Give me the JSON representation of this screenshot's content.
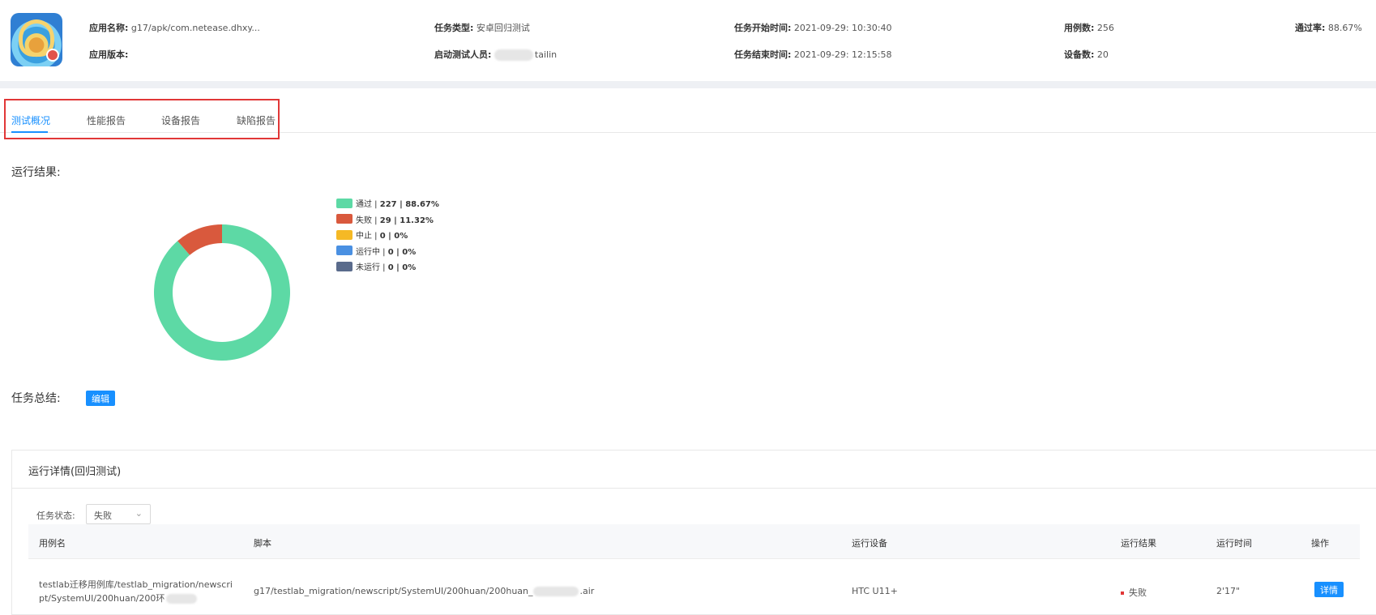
{
  "header": {
    "app_name_label": "应用名称:",
    "app_name_value": "g17/apk/com.netease.dhxy...",
    "app_version_label": "应用版本:",
    "app_version_value": "",
    "task_type_label": "任务类型:",
    "task_type_value": "安卓回归测试",
    "launcher_label": "启动测试人员:",
    "launcher_value": "tailin",
    "start_time_label": "任务开始时间:",
    "start_time_value": "2021-09-29: 10:30:40",
    "end_time_label": "任务结束时间:",
    "end_time_value": "2021-09-29: 12:15:58",
    "case_count_label": "用例数:",
    "case_count_value": "256",
    "device_count_label": "设备数:",
    "device_count_value": "20",
    "pass_rate_label": "通过率:",
    "pass_rate_value": "88.67%"
  },
  "tabs": [
    {
      "label": "测试概况",
      "active": true
    },
    {
      "label": "性能报告",
      "active": false
    },
    {
      "label": "设备报告",
      "active": false
    },
    {
      "label": "缺陷报告",
      "active": false
    }
  ],
  "run_result": {
    "label": "运行结果:",
    "chart_data": {
      "type": "pie",
      "style": "donut",
      "series": [
        {
          "name": "通过",
          "count": 227,
          "percent": "88.67%",
          "color": "#5dd9a5"
        },
        {
          "name": "失败",
          "count": 29,
          "percent": "11.32%",
          "color": "#d9593d"
        },
        {
          "name": "中止",
          "count": 0,
          "percent": "0%",
          "color": "#f5b925"
        },
        {
          "name": "运行中",
          "count": 0,
          "percent": "0%",
          "color": "#4a90e2"
        },
        {
          "name": "未运行",
          "count": 0,
          "percent": "0%",
          "color": "#5a6b8c"
        }
      ],
      "legend_position": "right"
    }
  },
  "summary": {
    "label": "任务总结:",
    "edit_label": "编辑"
  },
  "details": {
    "title": "运行详情(回归测试)",
    "filter_label": "任务状态:",
    "filter_value": "失败",
    "columns": [
      "用例名",
      "脚本",
      "运行设备",
      "运行结果",
      "运行时间",
      "操作"
    ],
    "rows": [
      {
        "case_name": "testlab迁移用例库/testlab_migration/newscript/SystemUI/200huan/200环",
        "script_prefix": "g17/testlab_migration/newscript/SystemUI/200huan/200huan_",
        "script_suffix": ".air",
        "device": "HTC U11+",
        "result": "失败",
        "duration": "2'17\"",
        "action_label": "详情"
      }
    ]
  },
  "colors": {
    "accent": "#1890ff",
    "highlight_border": "#e13737",
    "fail_dot": "#e13737"
  }
}
